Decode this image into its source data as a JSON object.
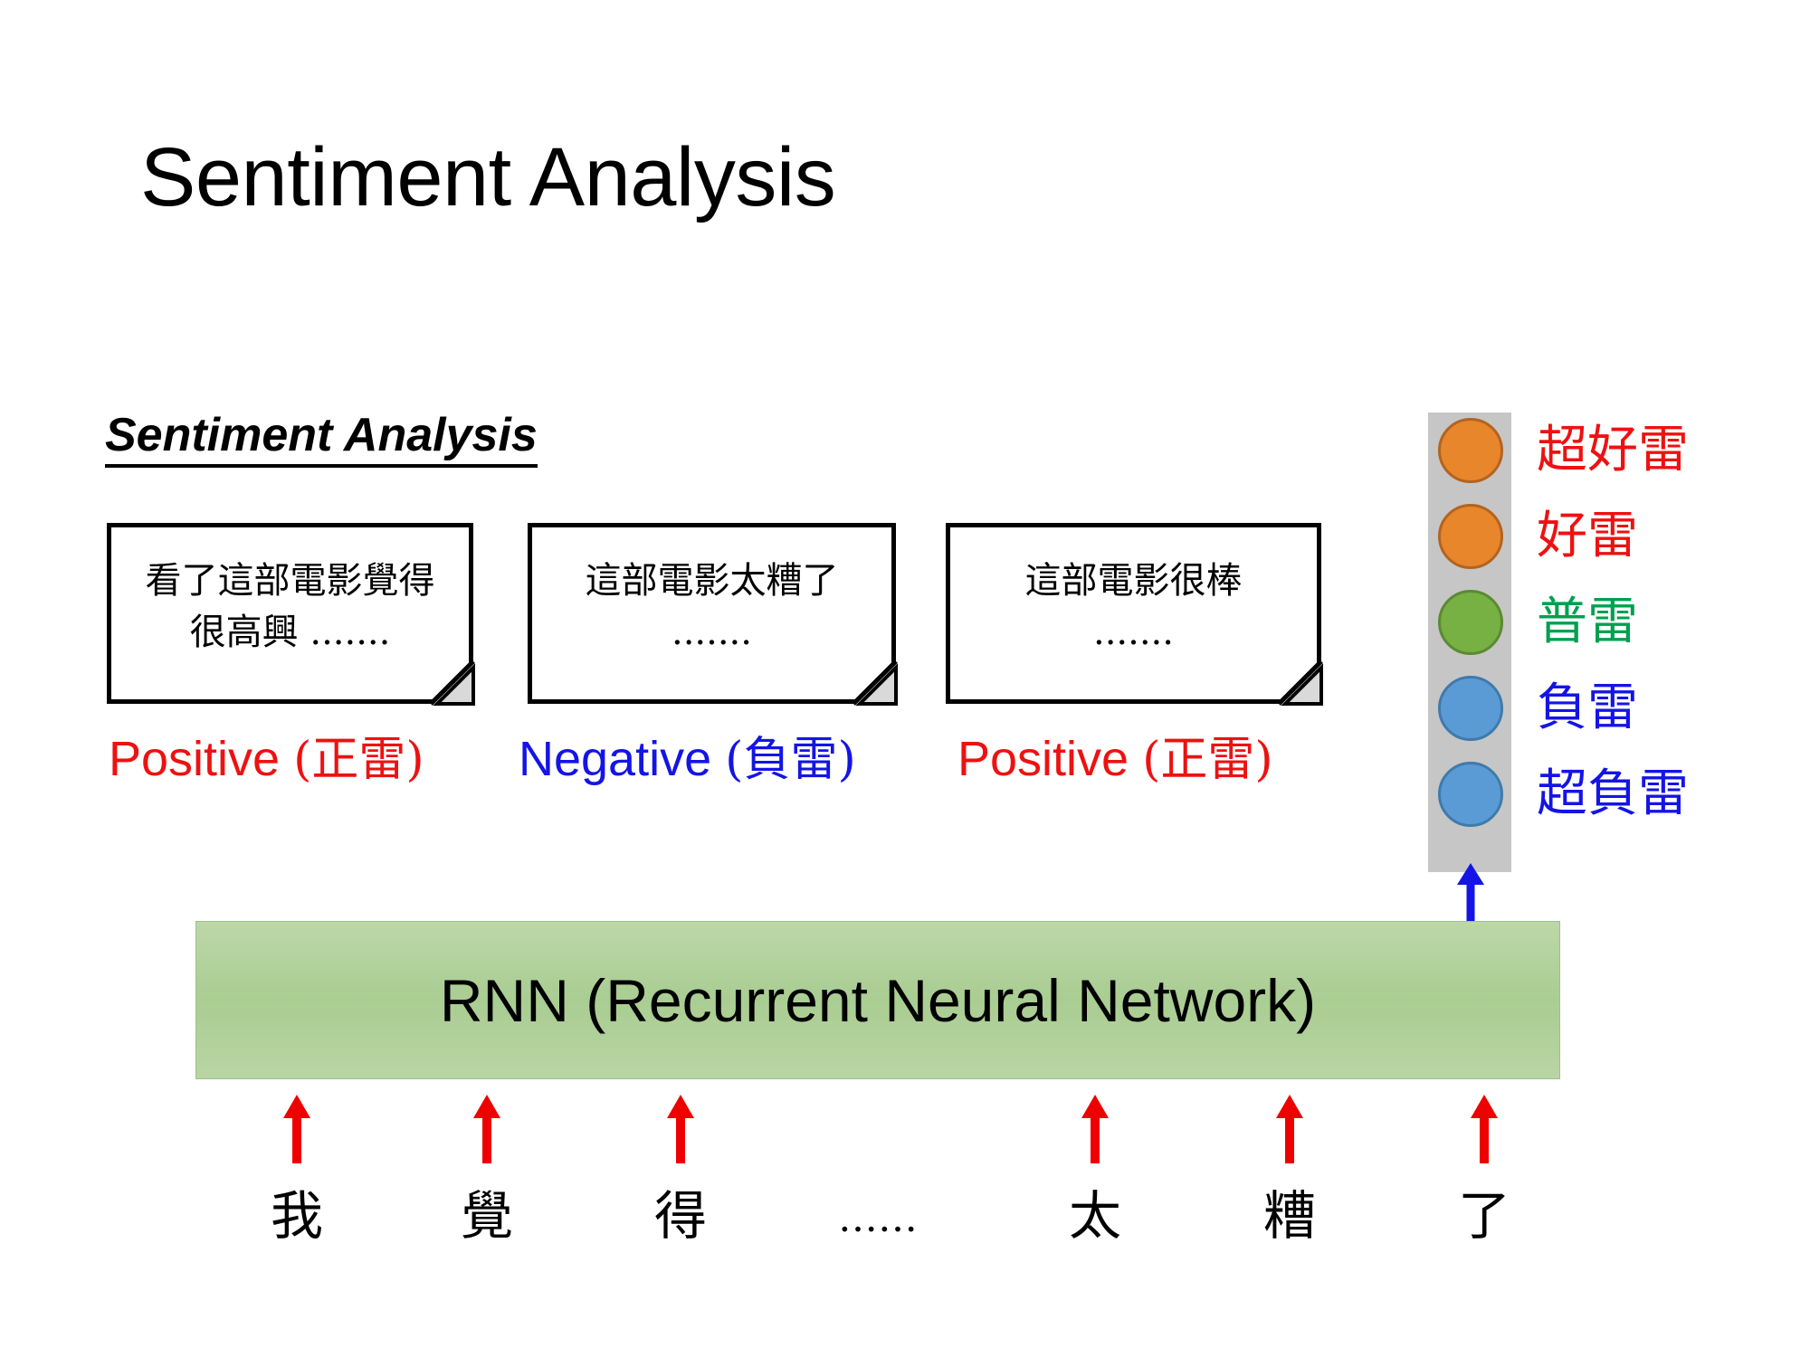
{
  "slide": {
    "title": "Sentiment Analysis",
    "section_heading": "Sentiment Analysis"
  },
  "reviews": [
    {
      "text": "看了這部電影覺得很高興 .......",
      "label_en": "Positive",
      "label_zh": "(正雷)",
      "label_color": "#ee1111",
      "polarity": "positive"
    },
    {
      "text": "這部電影太糟了 .......",
      "label_en": "Negative",
      "label_zh": "(負雷)",
      "label_color": "#1414e6",
      "polarity": "negative"
    },
    {
      "text": "這部電影很棒 .......",
      "label_en": "Positive",
      "label_zh": "(正雷)",
      "label_color": "#ee1111",
      "polarity": "positive"
    }
  ],
  "rating_scale": {
    "bar_color": "#c6c6c6",
    "levels": [
      {
        "label": "超好雷",
        "dot_color": "#e8862b",
        "dot_border": "#b36321",
        "text_color": "#ee1111",
        "dot_kind": "orange"
      },
      {
        "label": "好雷",
        "dot_color": "#e8862b",
        "dot_border": "#b36321",
        "text_color": "#ee1111",
        "dot_kind": "orange"
      },
      {
        "label": "普雷",
        "dot_color": "#77b043",
        "dot_border": "#5b8a32",
        "text_color": "#00a050",
        "dot_kind": "green"
      },
      {
        "label": "負雷",
        "dot_color": "#5b9bd5",
        "dot_border": "#3f7aab",
        "text_color": "#1414e6",
        "dot_kind": "blue"
      },
      {
        "label": "超負雷",
        "dot_color": "#5b9bd5",
        "dot_border": "#3f7aab",
        "text_color": "#1414e6",
        "dot_kind": "blue"
      }
    ]
  },
  "model": {
    "name": "RNN (Recurrent Neural Network)",
    "fill_color": "#a9cd92"
  },
  "arrows": {
    "input_arrow_color": "#ee0000",
    "output_arrow_color": "#1414e6"
  },
  "input_tokens": [
    {
      "text": "我",
      "has_arrow": true
    },
    {
      "text": "覺",
      "has_arrow": true
    },
    {
      "text": "得",
      "has_arrow": true
    },
    {
      "text": "……",
      "has_arrow": false
    },
    {
      "text": "太",
      "has_arrow": true
    },
    {
      "text": "糟",
      "has_arrow": true
    },
    {
      "text": "了",
      "has_arrow": true
    }
  ]
}
